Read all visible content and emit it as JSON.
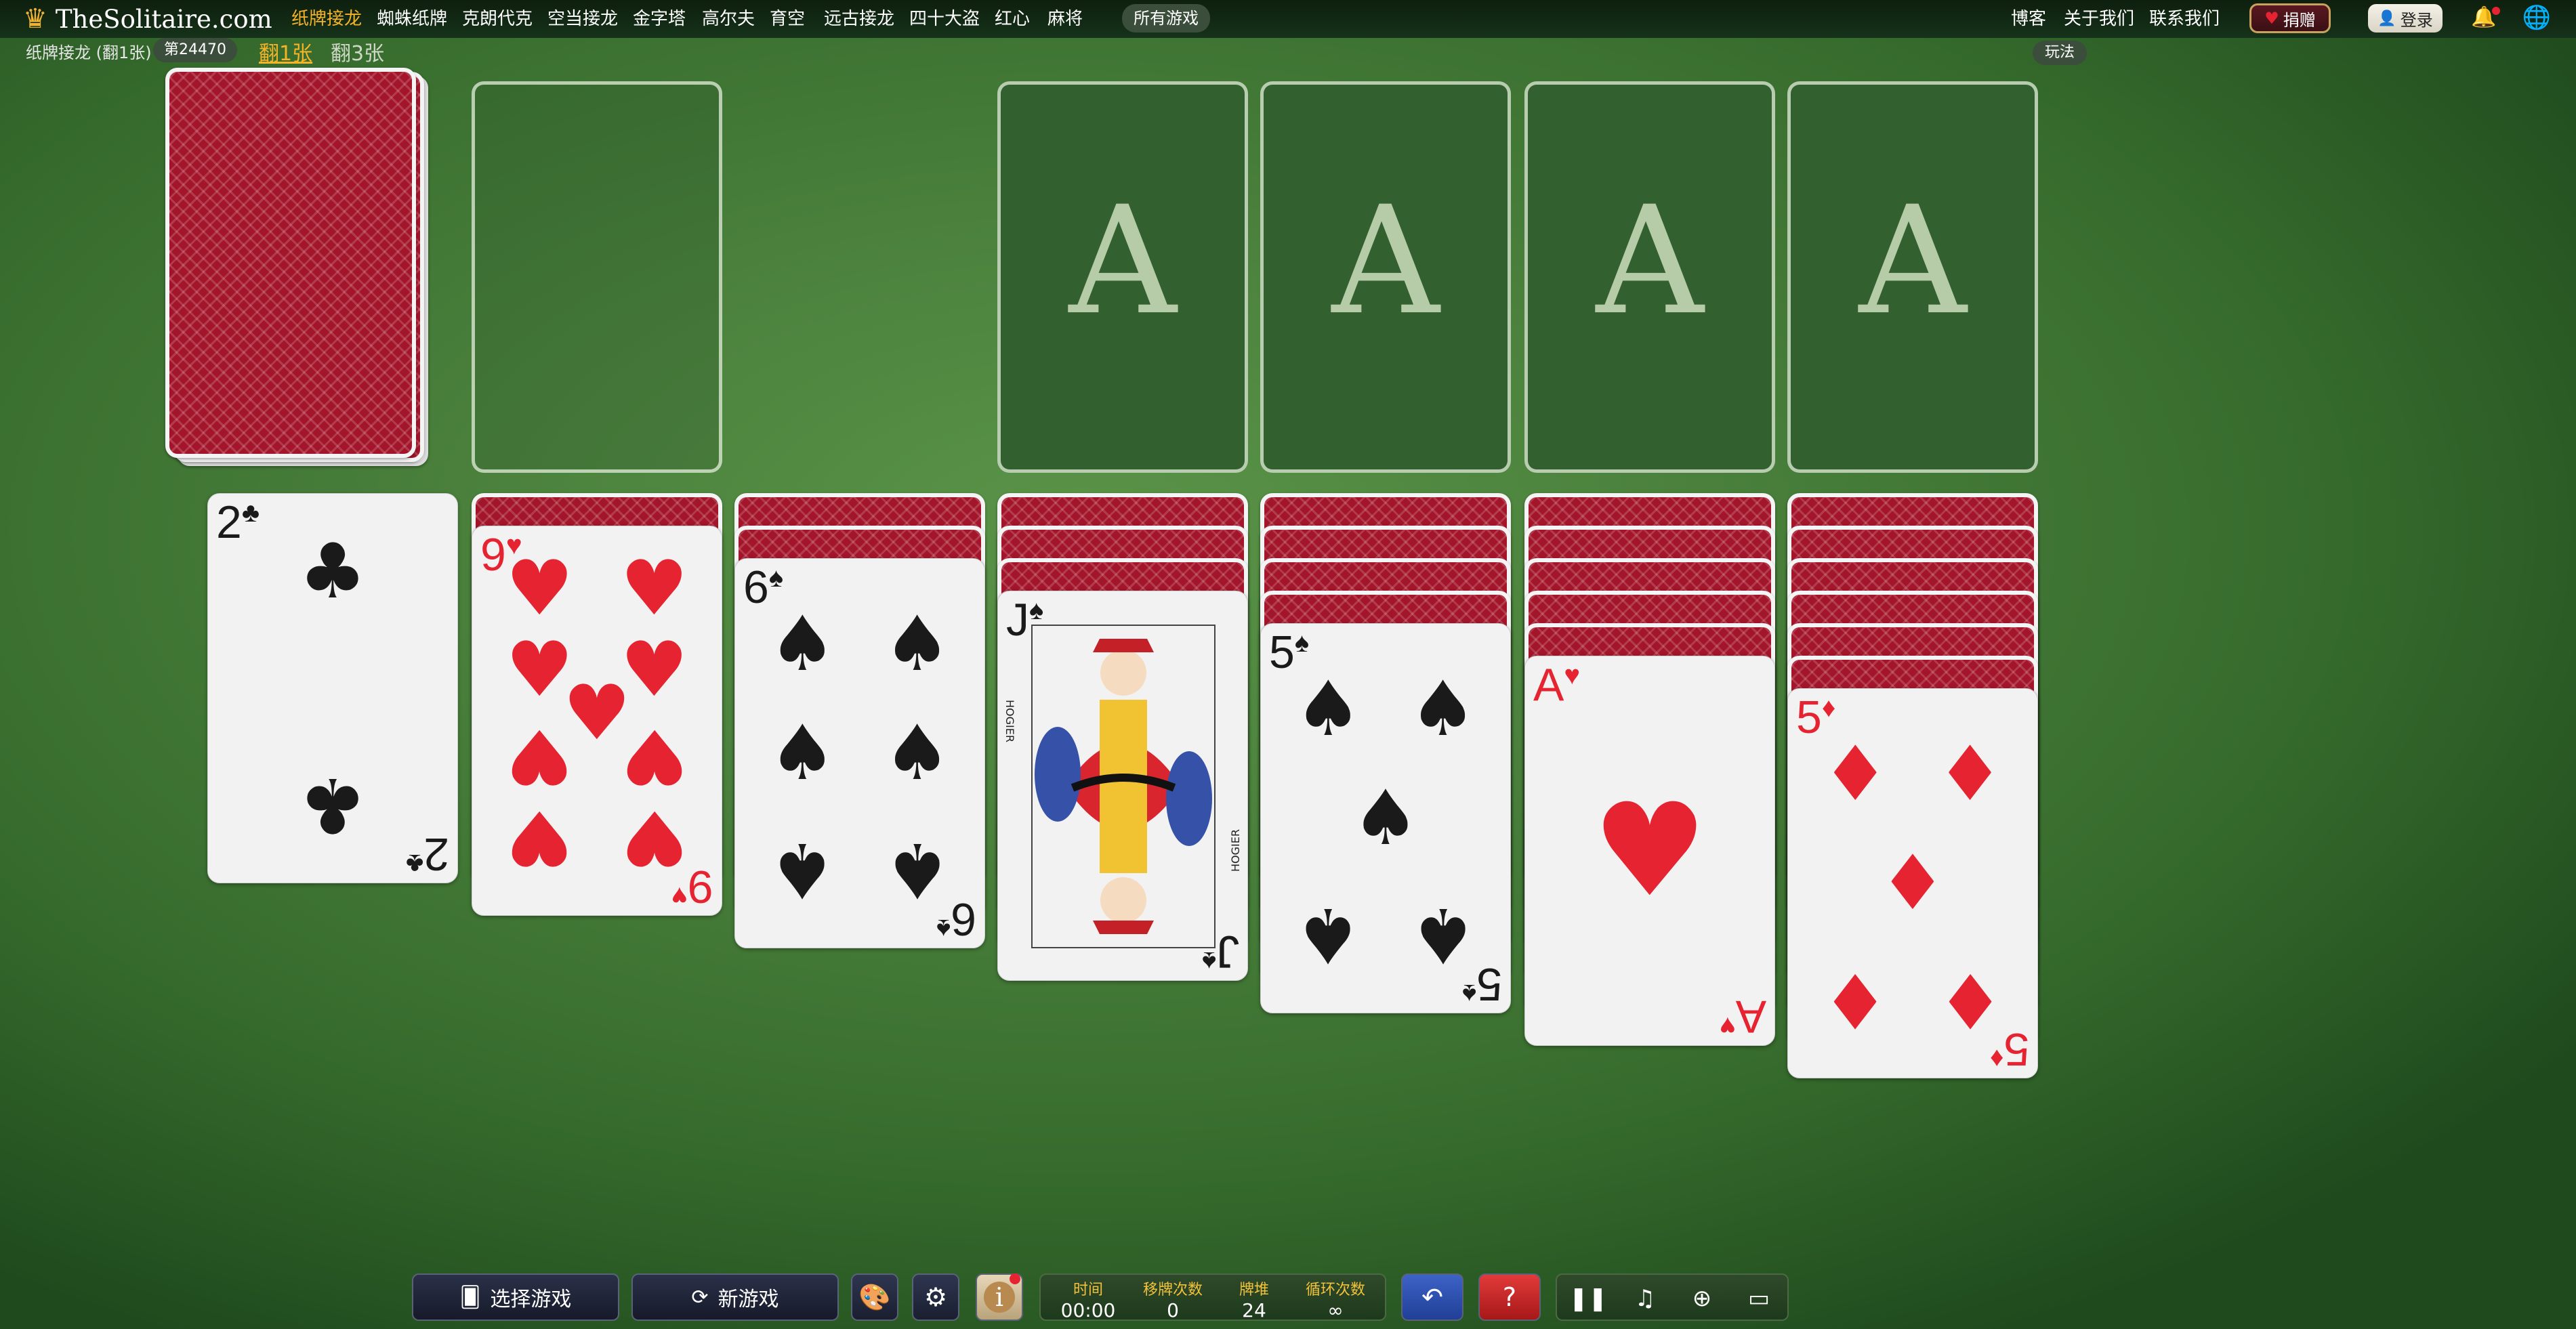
{
  "site": {
    "name": "TheSolitaire.com"
  },
  "nav": {
    "items": [
      "纸牌接龙",
      "蜘蛛纸牌",
      "克朗代克",
      "空当接龙",
      "金字塔",
      "高尔夫",
      "育空",
      "远古接龙",
      "四十大盗",
      "红心",
      "麻将"
    ],
    "all_games": "所有游戏",
    "right": [
      "博客",
      "关于我们",
      "联系我们"
    ],
    "donate": "捐赠",
    "login": "登录",
    "play_rules": "玩法"
  },
  "game": {
    "title": "纸牌接龙 (翻1张)",
    "number": "第24470",
    "mode_active": "翻1张",
    "mode_other": "翻3张"
  },
  "colors": {
    "felt": "#4a803c",
    "card_back": "#a3152a",
    "red_suit": "#e62431",
    "accent": "#f6b328"
  },
  "foundations": [
    "A",
    "A",
    "A",
    "A"
  ],
  "tableau": [
    {
      "hidden": 0,
      "rank": "2",
      "suit": "♣",
      "color": "black"
    },
    {
      "hidden": 1,
      "rank": "9",
      "suit": "♥",
      "color": "red"
    },
    {
      "hidden": 2,
      "rank": "6",
      "suit": "♠",
      "color": "black"
    },
    {
      "hidden": 3,
      "rank": "J",
      "suit": "♠",
      "color": "black",
      "court": "HOGIER"
    },
    {
      "hidden": 4,
      "rank": "5",
      "suit": "♠",
      "color": "black"
    },
    {
      "hidden": 5,
      "rank": "A",
      "suit": "♥",
      "color": "red"
    },
    {
      "hidden": 6,
      "rank": "5",
      "suit": "♦",
      "color": "red"
    }
  ],
  "toolbar": {
    "select_game": "选择游戏",
    "new_game": "新游戏",
    "stats": [
      {
        "label": "时间",
        "value": "00:00"
      },
      {
        "label": "移牌次数",
        "value": "0"
      },
      {
        "label": "牌堆",
        "value": "24"
      },
      {
        "label": "循环次数",
        "value": "∞"
      }
    ],
    "icons": [
      "palette-icon",
      "gear-icon",
      "info-icon",
      "undo-icon",
      "help-icon",
      "pause-icon",
      "music-icon",
      "zoom-icon",
      "screen-icon"
    ]
  }
}
